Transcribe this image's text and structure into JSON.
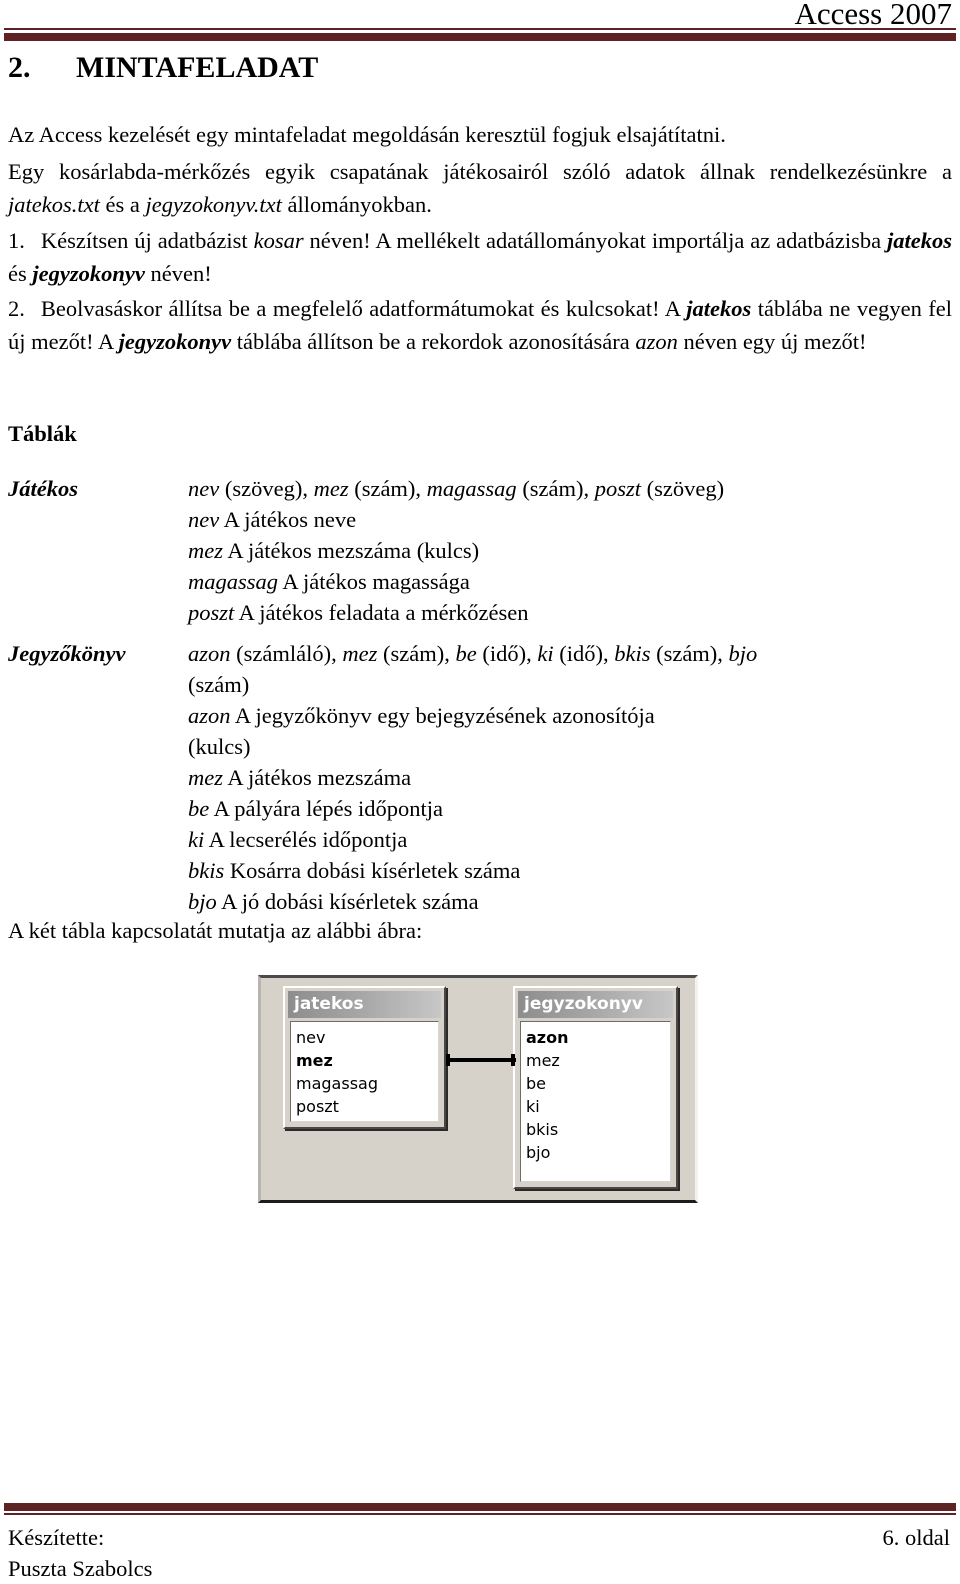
{
  "header": {
    "title": "Access 2007",
    "rule_color": "#5e2222"
  },
  "heading": {
    "number": "2.",
    "text": "MINTAFELADAT"
  },
  "paragraphs": {
    "p1": "Az Access kezelését egy mintafeladat megoldásán keresztül fogjuk elsajátítatni.",
    "p2_a": "Egy kosárlabda-mérkőzés egyik csapatának játékosairól szóló adatok állnak rendelkezésünkre a ",
    "p2_file1": "jatekos.txt",
    "p2_b": " és a ",
    "p2_file2": "jegyzokonyv.txt",
    "p2_c": " állományokban.",
    "p3_num": "1.",
    "p3_a": "Készítsen új adatbázist ",
    "p3_db": "kosar",
    "p3_b": " néven! A mellékelt adatállományokat importálja az adatbázisba ",
    "p3_t1": "jatekos",
    "p3_c": " és ",
    "p3_t2": "jegyzokonyv",
    "p3_d": " néven!",
    "p4_num": "2.",
    "p4_a": "Beolvasáskor állítsa be a megfelelő adatformátumokat és kulcsokat! A ",
    "p4_t1": "jatekos",
    "p4_b": " táblába ne vegyen fel új mezőt! A ",
    "p4_t2": "jegyzokonyv",
    "p4_c": " táblába állítson be a rekordok azonosítására ",
    "p4_f": "azon",
    "p4_d": " néven egy új mezőt!"
  },
  "tables_section": {
    "heading": "Táblák",
    "jatekos": {
      "name": "Játékos",
      "signature": [
        {
          "field": "nev",
          "type": " (szöveg), "
        },
        {
          "field": "mez",
          "type": " (szám), "
        },
        {
          "field": "magassag",
          "type": " (szám), "
        },
        {
          "field": "poszt",
          "type": " (szöveg)"
        }
      ],
      "descriptions": [
        {
          "field": "nev",
          "text": " A játékos neve"
        },
        {
          "field": "mez",
          "text": " A játékos mezszáma (kulcs)"
        },
        {
          "field": "magassag",
          "text": " A játékos magassága"
        },
        {
          "field": "poszt",
          "text": " A játékos feladata a mérkőzésen"
        }
      ]
    },
    "jegyzokonyv": {
      "name": "Jegyzőkönyv",
      "signature": [
        {
          "field": "azon",
          "type": " (számláló), "
        },
        {
          "field": "mez",
          "type": " (szám), "
        },
        {
          "field": "be",
          "type": " (idő), "
        },
        {
          "field": "ki",
          "type": " (idő), "
        },
        {
          "field": "bkis",
          "type": " (szám), "
        },
        {
          "field": "bjo",
          "type": " (szám)"
        }
      ],
      "descriptions": [
        {
          "field": "azon",
          "text": " A jegyzőkönyv egy bejegyzésének azonosítója (kulcs)"
        },
        {
          "field": "mez",
          "text": " A játékos mezszáma"
        },
        {
          "field": "be",
          "text": " A pályára lépés időpontja"
        },
        {
          "field": "ki",
          "text": " A lecserélés időpontja"
        },
        {
          "field": "bkis",
          "text": " Kosárra dobási kísérletek száma"
        },
        {
          "field": "bjo",
          "text": " A jó dobási kísérletek száma"
        }
      ]
    },
    "closing": "A két tábla kapcsolatát mutatja az alábbi ábra:"
  },
  "diagram": {
    "tables": [
      {
        "title": "jatekos",
        "fields": [
          {
            "name": "nev",
            "key": false
          },
          {
            "name": "mez",
            "key": true
          },
          {
            "name": "magassag",
            "key": false
          },
          {
            "name": "poszt",
            "key": false
          }
        ]
      },
      {
        "title": "jegyzokonyv",
        "fields": [
          {
            "name": "azon",
            "key": true
          },
          {
            "name": "mez",
            "key": false
          },
          {
            "name": "be",
            "key": false
          },
          {
            "name": "ki",
            "key": false
          },
          {
            "name": "bkis",
            "key": false
          },
          {
            "name": "bjo",
            "key": false
          }
        ]
      }
    ]
  },
  "footer": {
    "made_by_label": "Készítette:",
    "author": "Puszta Szabolcs",
    "page": "6. oldal"
  }
}
